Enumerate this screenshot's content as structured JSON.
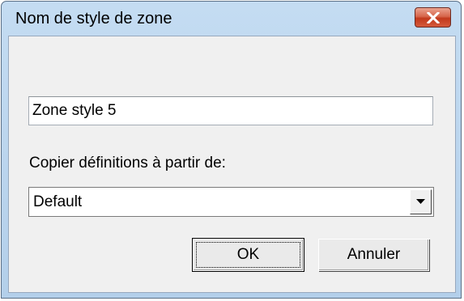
{
  "window": {
    "title": "Nom de style de zone",
    "close_icon": "close-icon"
  },
  "form": {
    "name_value": "Zone style 5",
    "copy_label": "Copier définitions à partir de:",
    "copy_selected": "Default",
    "dropdown_icon": "chevron-down-icon"
  },
  "buttons": {
    "ok_label": "OK",
    "cancel_label": "Annuler"
  }
}
